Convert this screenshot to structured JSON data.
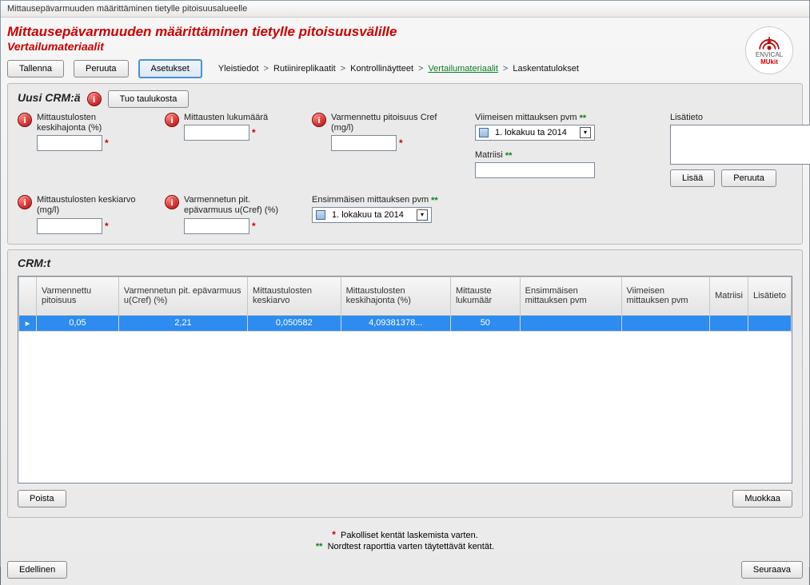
{
  "window_title": "Mittausepävarmuuden määrittäminen tietylle pitoisuusalueelle",
  "header": {
    "title": "Mittausepävarmuuden määrittäminen tietylle pitoisuusvälille",
    "subtitle": "Vertailumateriaalit"
  },
  "logo": {
    "line1": "ENVICAL",
    "line2": "MUkit"
  },
  "toolbar": {
    "save": "Tallenna",
    "cancel": "Peruuta",
    "settings": "Asetukset"
  },
  "breadcrumb": {
    "items": [
      "Yleistiedot",
      "Rutiinireplikaatit",
      "Kontrollinäytteet",
      "Vertailumateriaalit",
      "Laskentatulokset"
    ],
    "current_index": 3
  },
  "uusi_crm": {
    "group_title": "Uusi CRM:ä",
    "import_btn": "Tuo taulukosta",
    "fields": {
      "keskihajonta": {
        "label": "Mittaustulosten keskihajonta (%)",
        "value": ""
      },
      "lukumaara": {
        "label": "Mittausten lukumäärä",
        "value": ""
      },
      "cref": {
        "label": "Varmennettu pitoisuus Cref (mg/l)",
        "value": ""
      },
      "viimeisen_pvm": {
        "label": "Viimeisen mittauksen pvm",
        "value": "1. lokakuu ta 2014"
      },
      "lisatieto": {
        "label": "Lisätieto",
        "value": ""
      },
      "keskiarvo": {
        "label": "Mittaustulosten keskiarvo (mg/l)",
        "value": ""
      },
      "ucref": {
        "label": "Varmennetun pit. epävarmuus u(Cref) (%)",
        "value": ""
      },
      "ensimmaisen_pvm": {
        "label": "Ensimmäisen mittauksen pvm",
        "value": "1. lokakuu ta 2014"
      },
      "matriisi": {
        "label": "Matriisi",
        "value": ""
      }
    },
    "add_btn": "Lisää",
    "cancel_btn": "Peruuta"
  },
  "crm_table": {
    "group_title": "CRM:t",
    "headers": [
      "Varmennettu pitoisuus",
      "Varmennetun pit. epävarmuus u(Cref) (%)",
      "Mittaustulosten keskiarvo",
      "Mittaustulosten keskihajonta (%)",
      "Mittauste lukumäär",
      "Ensimmäisen mittauksen pvm",
      "Viimeisen mittauksen pvm",
      "Matriisi",
      "Lisätieto"
    ],
    "rows": [
      {
        "cells": [
          "0,05",
          "2,21",
          "0,050582",
          "4,09381378...",
          "50",
          "",
          "",
          "",
          ""
        ]
      }
    ],
    "delete_btn": "Poista",
    "edit_btn": "Muokkaa"
  },
  "footnotes": {
    "required": "Pakolliset kentät laskemista varten.",
    "nordtest": "Nordtest raporttia varten täytettävät kentät."
  },
  "footer": {
    "prev": "Edellinen",
    "next": "Seuraava"
  }
}
